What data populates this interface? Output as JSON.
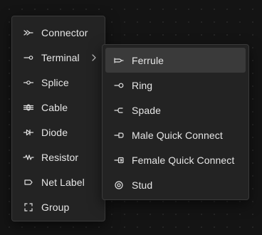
{
  "main_menu": {
    "items": [
      {
        "label": "Connector",
        "icon": "connector-icon"
      },
      {
        "label": "Terminal",
        "icon": "terminal-icon",
        "has_submenu": true
      },
      {
        "label": "Splice",
        "icon": "splice-icon"
      },
      {
        "label": "Cable",
        "icon": "cable-icon"
      },
      {
        "label": "Diode",
        "icon": "diode-icon"
      },
      {
        "label": "Resistor",
        "icon": "resistor-icon"
      },
      {
        "label": "Net Label",
        "icon": "net-label-icon"
      },
      {
        "label": "Group",
        "icon": "group-icon"
      }
    ]
  },
  "submenu": {
    "parent": "Terminal",
    "highlighted": "Ferrule",
    "items": [
      {
        "label": "Ferrule",
        "icon": "ferrule-icon"
      },
      {
        "label": "Ring",
        "icon": "ring-icon"
      },
      {
        "label": "Spade",
        "icon": "spade-icon"
      },
      {
        "label": "Male Quick Connect",
        "icon": "male-quick-connect-icon"
      },
      {
        "label": "Female Quick Connect",
        "icon": "female-quick-connect-icon"
      },
      {
        "label": "Stud",
        "icon": "stud-icon"
      }
    ]
  },
  "colors": {
    "background": "#141414",
    "menu_bg": "#232323",
    "menu_border": "#3a3a3a",
    "highlight_bg": "#3a3a3a",
    "text": "#e6e6e6"
  }
}
